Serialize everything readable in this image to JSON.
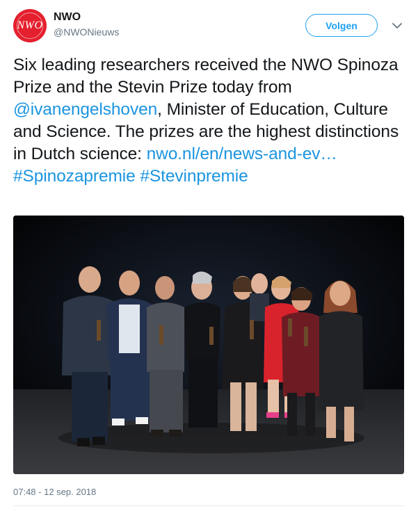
{
  "account": {
    "avatar_text": "NWO",
    "name": "NWO",
    "handle": "@NWONieuws"
  },
  "follow_button": {
    "label": "Volgen"
  },
  "tweet": {
    "segments": [
      {
        "text": "Six leading researchers received the NWO Spinoza Prize and the Stevin Prize today from ",
        "type": "text"
      },
      {
        "text": "@ivanengelshoven",
        "type": "mention"
      },
      {
        "text": ", Minister of Education, Culture and Science. The prizes are the highest distinctions in Dutch science: ",
        "type": "text"
      },
      {
        "text": "nwo.nl/en/news-and-ev…",
        "type": "link"
      },
      {
        "text": " ",
        "type": "text"
      },
      {
        "text": "#Spinozapremie",
        "type": "hashtag"
      },
      {
        "text": " ",
        "type": "text"
      },
      {
        "text": "#Stevinpremie",
        "type": "hashtag"
      }
    ]
  },
  "photo": {
    "description_icon": "group-photo"
  },
  "timestamp": "07:48 - 12 sep. 2018",
  "colors": {
    "brand_red": "#e4202e",
    "link_blue": "#1b95e0",
    "follow_blue": "#1da1f2",
    "meta_gray": "#657786"
  }
}
